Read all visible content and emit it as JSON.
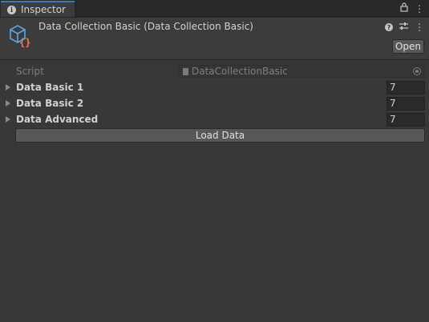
{
  "tab": {
    "title": "Inspector"
  },
  "header": {
    "title": "Data Collection Basic (Data Collection Basic)",
    "open_label": "Open"
  },
  "script_row": {
    "label": "Script",
    "value": "DataCollectionBasic"
  },
  "fields": [
    {
      "label": "Data Basic 1",
      "value": "7"
    },
    {
      "label": "Data Basic 2",
      "value": "7"
    },
    {
      "label": "Data Advanced",
      "value": "7"
    }
  ],
  "load_button": {
    "label": "Load Data"
  },
  "icons": {
    "tab": "info-icon",
    "tab_tools": [
      "lock-icon",
      "menu-icon"
    ],
    "header": "script-component-icon",
    "header_tools": [
      "help-icon",
      "preset-icon",
      "menu-icon"
    ]
  },
  "colors": {
    "accent": "#3a79bb",
    "panel": "#383838",
    "button": "#585858"
  }
}
